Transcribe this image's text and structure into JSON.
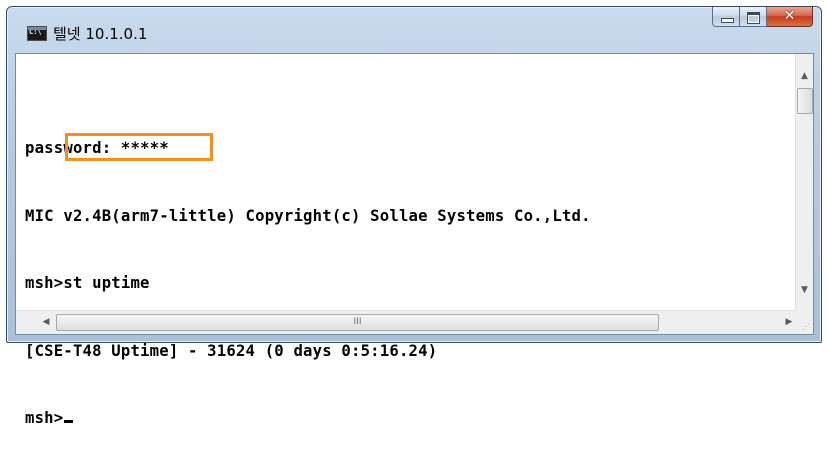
{
  "window": {
    "title": "텔넷 10.1.0.1",
    "app_icon": "cmd-icon",
    "buttons": {
      "minimize": "minimize-icon",
      "maximize": "maximize-icon",
      "close_glyph": "✕"
    }
  },
  "console": {
    "lines": [
      "",
      "password: *****",
      "MIC v2.4B(arm7-little) Copyright(c) Sollae Systems Co.,Ltd.",
      "msh>st uptime",
      "[CSE-T48 Uptime] - 31624 (0 days 0:5:16.24)",
      "msh>"
    ],
    "highlighted_command": "st uptime",
    "highlight_color": "#f39021"
  },
  "scrollbars": {
    "up_arrow": "▲",
    "down_arrow": "▼",
    "left_arrow": "◀",
    "right_arrow": "▶",
    "hthumb_grip": "III",
    "size_grip": "⋰"
  }
}
